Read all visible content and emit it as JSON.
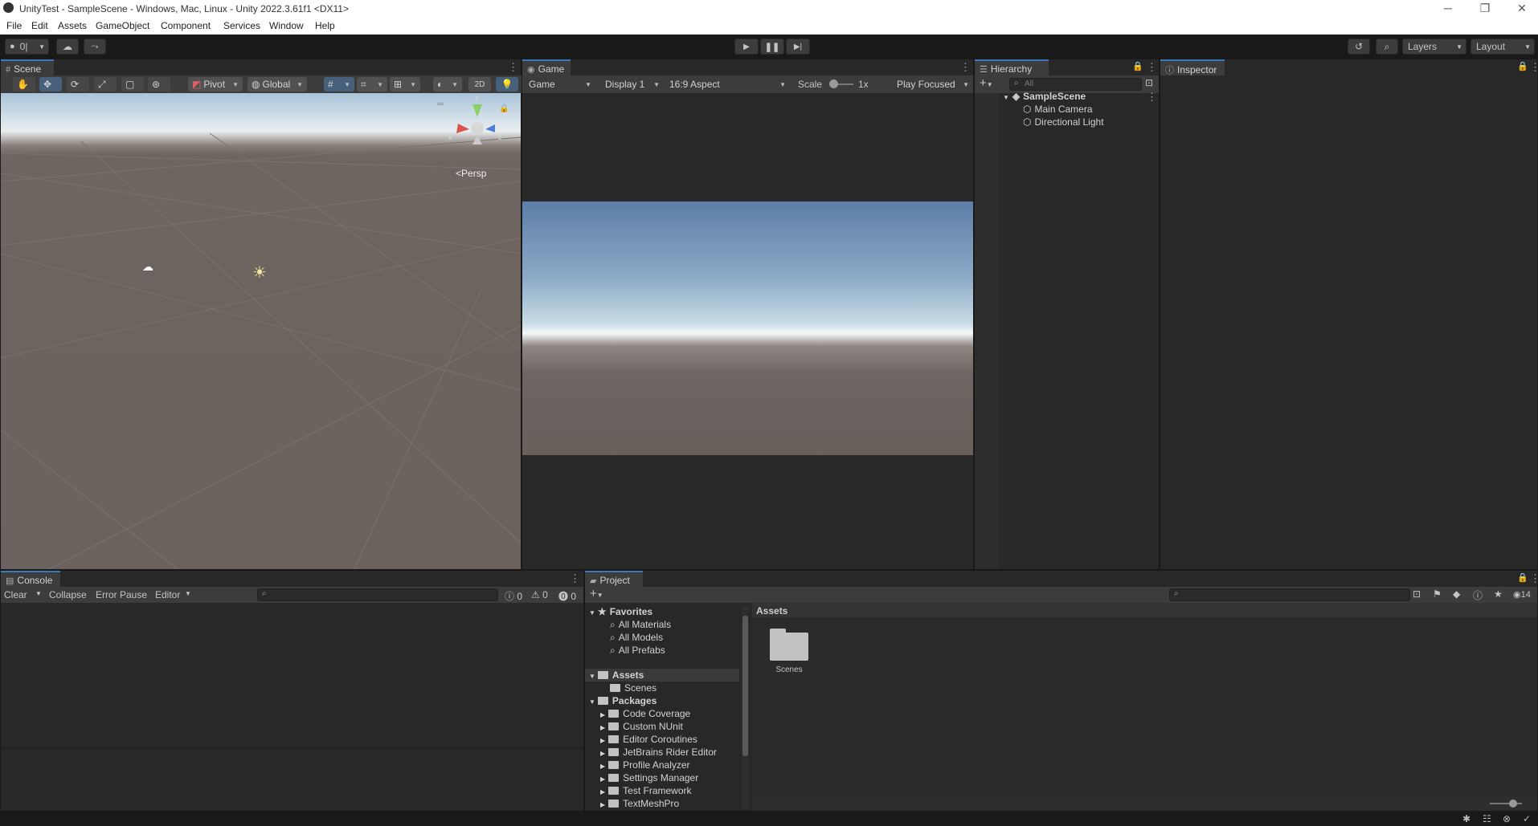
{
  "window": {
    "title": "UnityTest - SampleScene - Windows, Mac, Linux - Unity 2022.3.61f1 <DX11>",
    "minimize": "─",
    "maximize": "❐",
    "close": "✕"
  },
  "menu": [
    "File",
    "Edit",
    "Assets",
    "GameObject",
    "Component",
    "Services",
    "Window",
    "Help"
  ],
  "toolbar": {
    "account": "0|",
    "layers": "Layers",
    "layout": "Layout"
  },
  "scene": {
    "tab": "Scene",
    "pivot": "Pivot",
    "global": "Global",
    "twod": "2D",
    "persp": "Persp",
    "axis_x": "x",
    "axis_y": "y",
    "axis_z": "z"
  },
  "game": {
    "tab": "Game",
    "mode": "Game",
    "display": "Display 1",
    "aspect": "16:9 Aspect",
    "scale_label": "Scale",
    "scale_value": "1x",
    "play_mode": "Play Focused"
  },
  "hierarchy": {
    "tab": "Hierarchy",
    "search_placeholder": "All",
    "scene": "SampleScene",
    "items": [
      "Main Camera",
      "Directional Light"
    ]
  },
  "inspector": {
    "tab": "Inspector"
  },
  "console": {
    "tab": "Console",
    "clear": "Clear",
    "collapse": "Collapse",
    "error_pause": "Error Pause",
    "editor": "Editor",
    "log_count": "0",
    "warn_count": "0",
    "error_count": "0"
  },
  "project": {
    "tab": "Project",
    "favorites": "Favorites",
    "favorites_items": [
      "All Materials",
      "All Models",
      "All Prefabs"
    ],
    "assets": "Assets",
    "assets_items": [
      "Scenes"
    ],
    "packages": "Packages",
    "packages_items": [
      "Code Coverage",
      "Custom NUnit",
      "Editor Coroutines",
      "JetBrains Rider Editor",
      "Profile Analyzer",
      "Settings Manager",
      "Test Framework",
      "TextMeshPro"
    ],
    "breadcrumb": "Assets",
    "grid_items": [
      "Scenes"
    ],
    "hidden_count": "14"
  },
  "colors": {
    "accent": "#3a79bb",
    "panel": "#282828",
    "toolbar": "#191919"
  }
}
